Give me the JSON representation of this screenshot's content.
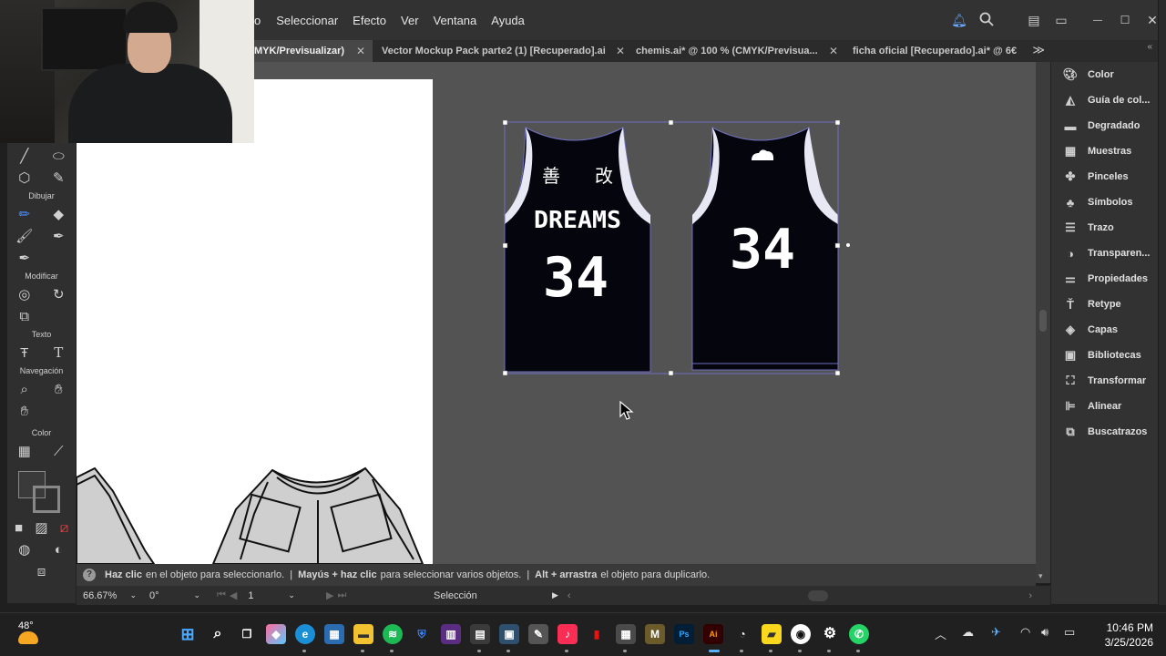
{
  "menu": {
    "items": [
      "o",
      "Seleccionar",
      "Efecto",
      "Ver",
      "Ventana",
      "Ayuda"
    ],
    "icons": [
      "bell-icon",
      "search-icon",
      "arrange-icon",
      "workspace-icon"
    ]
  },
  "window_controls": {
    "minimize": "—",
    "maximize": "☐",
    "close": "✕"
  },
  "tabs": [
    {
      "label": "MYK/Previsualizar)",
      "active": true
    },
    {
      "label": "Vector Mockup Pack parte2  (1) [Recuperado].ai",
      "active": false
    },
    {
      "label": "chemis.ai* @ 100 % (CMYK/Previsua...",
      "active": false
    },
    {
      "label": "ficha oficial [Recuperado].ai* @ 6€",
      "active": false
    }
  ],
  "toolbar": {
    "labels": {
      "draw": "Dibujar",
      "modify": "Modificar",
      "text": "Texto",
      "navigation": "Navegación",
      "color": "Color"
    }
  },
  "jerseys": {
    "front": {
      "kanji_left": "善",
      "kanji_right": "改",
      "name": "DREAMS",
      "number": "34"
    },
    "back": {
      "number": "34"
    },
    "fill_color": "#05050d",
    "trim_color": "#e8e8f5"
  },
  "panels": [
    {
      "icon": "color-icon",
      "label": "Color"
    },
    {
      "icon": "color-guide-icon",
      "label": "Guía de col..."
    },
    {
      "icon": "gradient-icon",
      "label": "Degradado"
    },
    {
      "icon": "swatches-icon",
      "label": "Muestras"
    },
    {
      "icon": "brushes-icon",
      "label": "Pinceles"
    },
    {
      "icon": "symbols-icon",
      "label": "Símbolos"
    },
    {
      "icon": "stroke-icon",
      "label": "Trazo"
    },
    {
      "icon": "transparency-icon",
      "label": "Transparen..."
    },
    {
      "icon": "properties-icon",
      "label": "Propiedades"
    },
    {
      "icon": "retype-icon",
      "label": "Retype"
    },
    {
      "icon": "layers-icon",
      "label": "Capas"
    },
    {
      "icon": "libraries-icon",
      "label": "Bibliotecas"
    },
    {
      "icon": "transform-icon",
      "label": "Transformar"
    },
    {
      "icon": "align-icon",
      "label": "Alinear"
    },
    {
      "icon": "pathfinder-icon",
      "label": "Buscatrazos"
    }
  ],
  "help": {
    "icon": "?",
    "p1_bold": "Haz clic",
    "p1": "en el objeto para seleccionarlo.",
    "sep": "|",
    "p2_bold": "Mayús + haz clic",
    "p2": "para seleccionar varios objetos.",
    "p3_bold": "Alt + arrastra",
    "p3": "el objeto para duplicarlo."
  },
  "status": {
    "zoom": "66.67%",
    "rotation": "0°",
    "artboard": "1",
    "tool": "Selección"
  },
  "taskbar": {
    "weather": "48°",
    "time": "10:46 PM",
    "date": "3/25/2026"
  }
}
